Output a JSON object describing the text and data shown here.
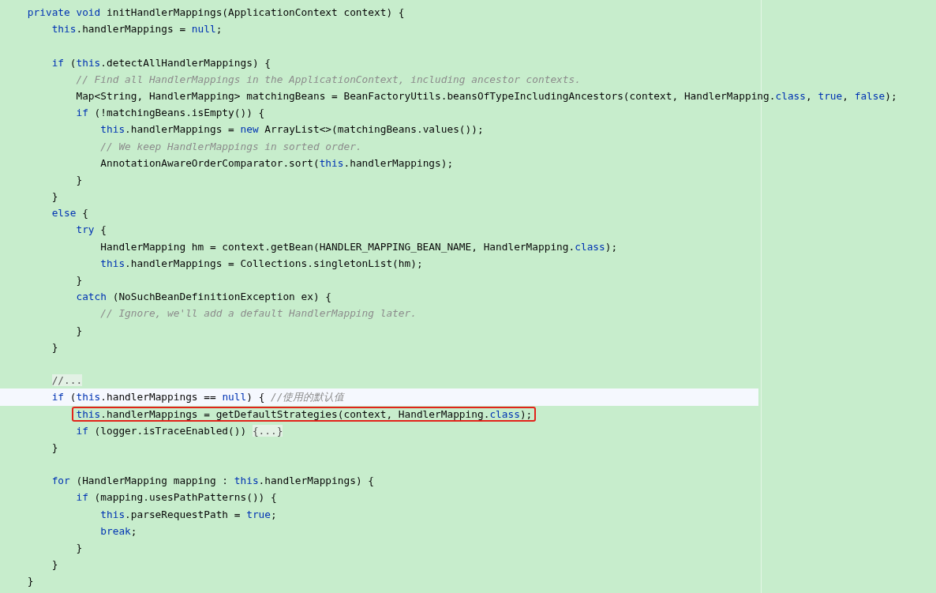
{
  "editor": {
    "lines": [
      {
        "kind": "code",
        "tokens": [
          {
            "kind": "kw",
            "text": "    private void "
          },
          {
            "kind": "plain",
            "text": "initHandlerMappings(ApplicationContext context) {"
          }
        ]
      },
      {
        "kind": "code",
        "tokens": [
          {
            "kind": "kw",
            "text": "        this"
          },
          {
            "kind": "plain",
            "text": ".handlerMappings = "
          },
          {
            "kind": "kw",
            "text": "null"
          },
          {
            "kind": "plain",
            "text": ";"
          }
        ]
      },
      {
        "kind": "blank"
      },
      {
        "kind": "code",
        "tokens": [
          {
            "kind": "kw",
            "text": "        if "
          },
          {
            "kind": "plain",
            "text": "("
          },
          {
            "kind": "kw",
            "text": "this"
          },
          {
            "kind": "plain",
            "text": ".detectAllHandlerMappings) {"
          }
        ]
      },
      {
        "kind": "code",
        "tokens": [
          {
            "kind": "comment",
            "text": "            // Find all HandlerMappings in the ApplicationContext, including ancestor contexts."
          }
        ]
      },
      {
        "kind": "code",
        "tokens": [
          {
            "kind": "plain",
            "text": "            Map<String, HandlerMapping> matchingBeans = BeanFactoryUtils.beansOfTypeIncludingAncestors(context, HandlerMapping."
          },
          {
            "kind": "kw",
            "text": "class"
          },
          {
            "kind": "plain",
            "text": ", "
          },
          {
            "kind": "kw",
            "text": "true"
          },
          {
            "kind": "plain",
            "text": ", "
          },
          {
            "kind": "kw",
            "text": "false"
          },
          {
            "kind": "plain",
            "text": ");"
          }
        ]
      },
      {
        "kind": "code",
        "tokens": [
          {
            "kind": "kw",
            "text": "            if "
          },
          {
            "kind": "plain",
            "text": "(!matchingBeans.isEmpty()) {"
          }
        ]
      },
      {
        "kind": "code",
        "tokens": [
          {
            "kind": "kw",
            "text": "                this"
          },
          {
            "kind": "plain",
            "text": ".handlerMappings = "
          },
          {
            "kind": "kw",
            "text": "new "
          },
          {
            "kind": "plain",
            "text": "ArrayList<>(matchingBeans.values());"
          }
        ]
      },
      {
        "kind": "code",
        "tokens": [
          {
            "kind": "comment",
            "text": "                // We keep HandlerMappings in sorted order."
          }
        ]
      },
      {
        "kind": "code",
        "tokens": [
          {
            "kind": "plain",
            "text": "                AnnotationAwareOrderComparator.sort("
          },
          {
            "kind": "kw",
            "text": "this"
          },
          {
            "kind": "plain",
            "text": ".handlerMappings);"
          }
        ]
      },
      {
        "kind": "code",
        "tokens": [
          {
            "kind": "plain",
            "text": "            }"
          }
        ]
      },
      {
        "kind": "code",
        "tokens": [
          {
            "kind": "plain",
            "text": "        }"
          }
        ]
      },
      {
        "kind": "code",
        "tokens": [
          {
            "kind": "kw",
            "text": "        else "
          },
          {
            "kind": "plain",
            "text": "{"
          }
        ]
      },
      {
        "kind": "code",
        "tokens": [
          {
            "kind": "kw",
            "text": "            try "
          },
          {
            "kind": "plain",
            "text": "{"
          }
        ]
      },
      {
        "kind": "code",
        "tokens": [
          {
            "kind": "plain",
            "text": "                HandlerMapping hm = context.getBean(HANDLER_MAPPING_BEAN_NAME, HandlerMapping."
          },
          {
            "kind": "kw",
            "text": "class"
          },
          {
            "kind": "plain",
            "text": ");"
          }
        ]
      },
      {
        "kind": "code",
        "tokens": [
          {
            "kind": "kw",
            "text": "                this"
          },
          {
            "kind": "plain",
            "text": ".handlerMappings = Collections.singletonList(hm);"
          }
        ]
      },
      {
        "kind": "code",
        "tokens": [
          {
            "kind": "plain",
            "text": "            }"
          }
        ]
      },
      {
        "kind": "code",
        "tokens": [
          {
            "kind": "kw",
            "text": "            catch "
          },
          {
            "kind": "plain",
            "text": "(NoSuchBeanDefinitionException ex) {"
          }
        ]
      },
      {
        "kind": "code",
        "tokens": [
          {
            "kind": "comment",
            "text": "                // Ignore, we'll add a default HandlerMapping later."
          }
        ]
      },
      {
        "kind": "code",
        "tokens": [
          {
            "kind": "plain",
            "text": "            }"
          }
        ]
      },
      {
        "kind": "code",
        "tokens": [
          {
            "kind": "plain",
            "text": "        }"
          }
        ]
      },
      {
        "kind": "blank"
      },
      {
        "kind": "code",
        "tokens": [
          {
            "kind": "fold",
            "text": "        //..."
          }
        ]
      },
      {
        "kind": "code",
        "current": true,
        "tokens": [
          {
            "kind": "kw",
            "text": "        if "
          },
          {
            "kind": "plain",
            "text": "("
          },
          {
            "kind": "kw",
            "text": "this"
          },
          {
            "kind": "plain",
            "text": ".handlerMappings == "
          },
          {
            "kind": "kw",
            "text": "null"
          },
          {
            "kind": "plain",
            "text": ") { "
          },
          {
            "kind": "comment",
            "text": "//使用的默认值"
          }
        ]
      },
      {
        "kind": "code",
        "boxed": true,
        "tokens": [
          {
            "kind": "kw",
            "text": "this"
          },
          {
            "kind": "plain",
            "text": ".handlerMappings = getDefaultStrategies(context, HandlerMapping."
          },
          {
            "kind": "kw",
            "text": "class"
          },
          {
            "kind": "plain",
            "text": ");"
          }
        ]
      },
      {
        "kind": "code",
        "tokens": [
          {
            "kind": "kw",
            "text": "            if "
          },
          {
            "kind": "plain",
            "text": "(logger.isTraceEnabled()) "
          },
          {
            "kind": "fold",
            "text": "{...}"
          }
        ]
      },
      {
        "kind": "code",
        "tokens": [
          {
            "kind": "plain",
            "text": "        }"
          }
        ]
      },
      {
        "kind": "blank"
      },
      {
        "kind": "code",
        "tokens": [
          {
            "kind": "kw",
            "text": "        for "
          },
          {
            "kind": "plain",
            "text": "(HandlerMapping mapping : "
          },
          {
            "kind": "kw",
            "text": "this"
          },
          {
            "kind": "plain",
            "text": ".handlerMappings) {"
          }
        ]
      },
      {
        "kind": "code",
        "tokens": [
          {
            "kind": "kw",
            "text": "            if "
          },
          {
            "kind": "plain",
            "text": "(mapping.usesPathPatterns()) {"
          }
        ]
      },
      {
        "kind": "code",
        "tokens": [
          {
            "kind": "kw",
            "text": "                this"
          },
          {
            "kind": "plain",
            "text": ".parseRequestPath = "
          },
          {
            "kind": "kw",
            "text": "true"
          },
          {
            "kind": "plain",
            "text": ";"
          }
        ]
      },
      {
        "kind": "code",
        "tokens": [
          {
            "kind": "kw",
            "text": "                break"
          },
          {
            "kind": "plain",
            "text": ";"
          }
        ]
      },
      {
        "kind": "code",
        "tokens": [
          {
            "kind": "plain",
            "text": "            }"
          }
        ]
      },
      {
        "kind": "code",
        "tokens": [
          {
            "kind": "plain",
            "text": "        }"
          }
        ]
      },
      {
        "kind": "code",
        "tokens": [
          {
            "kind": "plain",
            "text": "    }"
          }
        ]
      }
    ]
  }
}
